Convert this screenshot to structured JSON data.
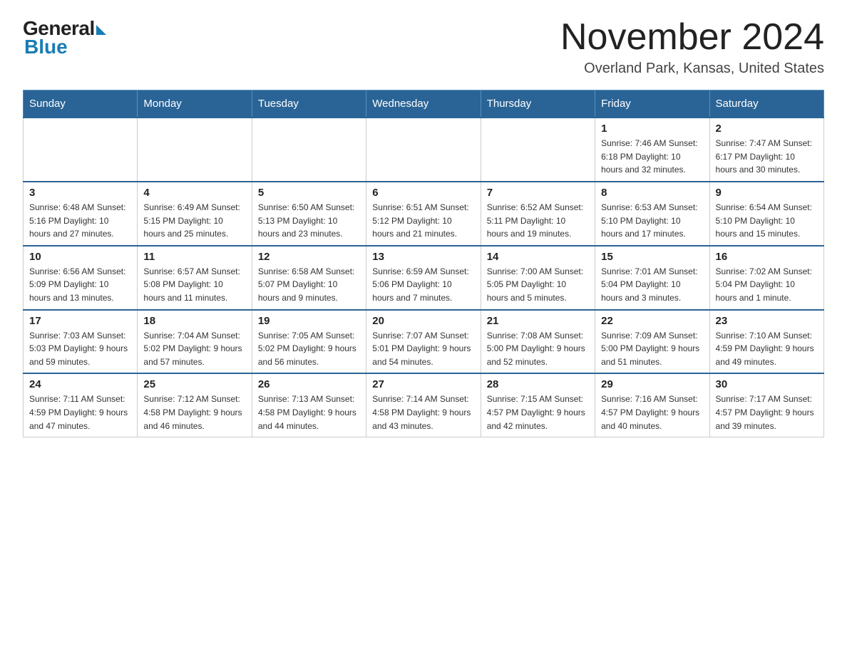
{
  "header": {
    "logo_general": "General",
    "logo_blue": "Blue",
    "month_title": "November 2024",
    "location": "Overland Park, Kansas, United States"
  },
  "weekdays": [
    "Sunday",
    "Monday",
    "Tuesday",
    "Wednesday",
    "Thursday",
    "Friday",
    "Saturday"
  ],
  "weeks": [
    [
      {
        "day": "",
        "info": ""
      },
      {
        "day": "",
        "info": ""
      },
      {
        "day": "",
        "info": ""
      },
      {
        "day": "",
        "info": ""
      },
      {
        "day": "",
        "info": ""
      },
      {
        "day": "1",
        "info": "Sunrise: 7:46 AM\nSunset: 6:18 PM\nDaylight: 10 hours and 32 minutes."
      },
      {
        "day": "2",
        "info": "Sunrise: 7:47 AM\nSunset: 6:17 PM\nDaylight: 10 hours and 30 minutes."
      }
    ],
    [
      {
        "day": "3",
        "info": "Sunrise: 6:48 AM\nSunset: 5:16 PM\nDaylight: 10 hours and 27 minutes."
      },
      {
        "day": "4",
        "info": "Sunrise: 6:49 AM\nSunset: 5:15 PM\nDaylight: 10 hours and 25 minutes."
      },
      {
        "day": "5",
        "info": "Sunrise: 6:50 AM\nSunset: 5:13 PM\nDaylight: 10 hours and 23 minutes."
      },
      {
        "day": "6",
        "info": "Sunrise: 6:51 AM\nSunset: 5:12 PM\nDaylight: 10 hours and 21 minutes."
      },
      {
        "day": "7",
        "info": "Sunrise: 6:52 AM\nSunset: 5:11 PM\nDaylight: 10 hours and 19 minutes."
      },
      {
        "day": "8",
        "info": "Sunrise: 6:53 AM\nSunset: 5:10 PM\nDaylight: 10 hours and 17 minutes."
      },
      {
        "day": "9",
        "info": "Sunrise: 6:54 AM\nSunset: 5:10 PM\nDaylight: 10 hours and 15 minutes."
      }
    ],
    [
      {
        "day": "10",
        "info": "Sunrise: 6:56 AM\nSunset: 5:09 PM\nDaylight: 10 hours and 13 minutes."
      },
      {
        "day": "11",
        "info": "Sunrise: 6:57 AM\nSunset: 5:08 PM\nDaylight: 10 hours and 11 minutes."
      },
      {
        "day": "12",
        "info": "Sunrise: 6:58 AM\nSunset: 5:07 PM\nDaylight: 10 hours and 9 minutes."
      },
      {
        "day": "13",
        "info": "Sunrise: 6:59 AM\nSunset: 5:06 PM\nDaylight: 10 hours and 7 minutes."
      },
      {
        "day": "14",
        "info": "Sunrise: 7:00 AM\nSunset: 5:05 PM\nDaylight: 10 hours and 5 minutes."
      },
      {
        "day": "15",
        "info": "Sunrise: 7:01 AM\nSunset: 5:04 PM\nDaylight: 10 hours and 3 minutes."
      },
      {
        "day": "16",
        "info": "Sunrise: 7:02 AM\nSunset: 5:04 PM\nDaylight: 10 hours and 1 minute."
      }
    ],
    [
      {
        "day": "17",
        "info": "Sunrise: 7:03 AM\nSunset: 5:03 PM\nDaylight: 9 hours and 59 minutes."
      },
      {
        "day": "18",
        "info": "Sunrise: 7:04 AM\nSunset: 5:02 PM\nDaylight: 9 hours and 57 minutes."
      },
      {
        "day": "19",
        "info": "Sunrise: 7:05 AM\nSunset: 5:02 PM\nDaylight: 9 hours and 56 minutes."
      },
      {
        "day": "20",
        "info": "Sunrise: 7:07 AM\nSunset: 5:01 PM\nDaylight: 9 hours and 54 minutes."
      },
      {
        "day": "21",
        "info": "Sunrise: 7:08 AM\nSunset: 5:00 PM\nDaylight: 9 hours and 52 minutes."
      },
      {
        "day": "22",
        "info": "Sunrise: 7:09 AM\nSunset: 5:00 PM\nDaylight: 9 hours and 51 minutes."
      },
      {
        "day": "23",
        "info": "Sunrise: 7:10 AM\nSunset: 4:59 PM\nDaylight: 9 hours and 49 minutes."
      }
    ],
    [
      {
        "day": "24",
        "info": "Sunrise: 7:11 AM\nSunset: 4:59 PM\nDaylight: 9 hours and 47 minutes."
      },
      {
        "day": "25",
        "info": "Sunrise: 7:12 AM\nSunset: 4:58 PM\nDaylight: 9 hours and 46 minutes."
      },
      {
        "day": "26",
        "info": "Sunrise: 7:13 AM\nSunset: 4:58 PM\nDaylight: 9 hours and 44 minutes."
      },
      {
        "day": "27",
        "info": "Sunrise: 7:14 AM\nSunset: 4:58 PM\nDaylight: 9 hours and 43 minutes."
      },
      {
        "day": "28",
        "info": "Sunrise: 7:15 AM\nSunset: 4:57 PM\nDaylight: 9 hours and 42 minutes."
      },
      {
        "day": "29",
        "info": "Sunrise: 7:16 AM\nSunset: 4:57 PM\nDaylight: 9 hours and 40 minutes."
      },
      {
        "day": "30",
        "info": "Sunrise: 7:17 AM\nSunset: 4:57 PM\nDaylight: 9 hours and 39 minutes."
      }
    ]
  ]
}
